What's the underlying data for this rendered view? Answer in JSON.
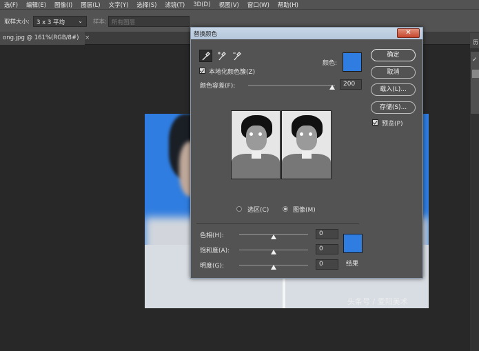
{
  "menubar": {
    "items": [
      "选(F)",
      "编辑(E)",
      "图像(I)",
      "图层(L)",
      "文字(Y)",
      "选择(S)",
      "滤镜(T)",
      "3D(D)",
      "视图(V)",
      "窗口(W)",
      "帮助(H)"
    ]
  },
  "options_bar": {
    "sample_size_label": "取样大小:",
    "sample_size_value": "3 x 3 平均",
    "sample_label": "样本:",
    "sample_value": "所有图层"
  },
  "document_tab": {
    "title": "ong.jpg @ 161%(RGB/8#)",
    "close": "×"
  },
  "right_panel": {
    "label": "历"
  },
  "canvas": {
    "watermark": "头条号 / 爱阳美术"
  },
  "dialog": {
    "title": "替换颜色",
    "close_glyph": "✕",
    "localized_clusters_label": "本地化颜色簇(Z)",
    "color_label": "颜色:",
    "fuzziness_label": "颜色容差(F):",
    "fuzziness_value": "200",
    "fuzziness_fraction": 1.0,
    "radio_selection": "选区(C)",
    "radio_image": "图像(M)",
    "selected_radio": "image",
    "hue_label": "色相(H):",
    "hue_value": "0",
    "saturation_label": "饱和度(A):",
    "saturation_value": "0",
    "lightness_label": "明度(G):",
    "lightness_value": "0",
    "result_label": "结果",
    "buttons": {
      "ok": "确定",
      "cancel": "取消",
      "load": "载入(L)...",
      "save": "存储(S)..."
    },
    "preview_label": "预览(P)",
    "swatch_color": "#2f7de0",
    "result_color": "#2f7de0"
  }
}
